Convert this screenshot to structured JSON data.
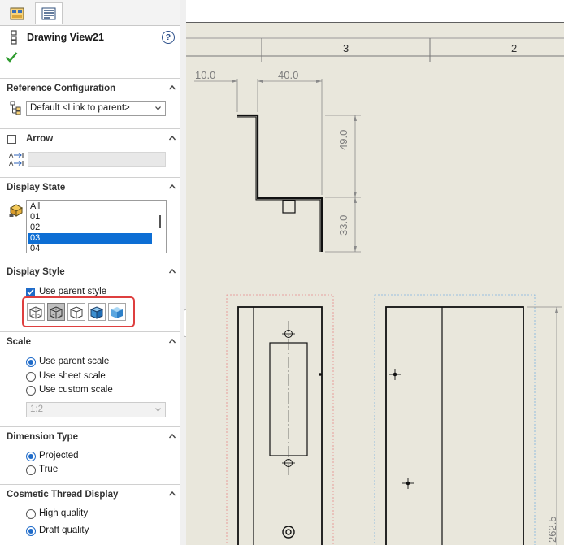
{
  "title": "Drawing View21",
  "help_label": "?",
  "sections": {
    "reference_configuration": {
      "header": "Reference Configuration",
      "value": "Default <Link to parent>"
    },
    "arrow": {
      "header": "Arrow",
      "checked": false
    },
    "display_state": {
      "header": "Display State",
      "items": [
        "All",
        "01",
        "02",
        "03",
        "04"
      ],
      "selected": "03"
    },
    "display_style": {
      "header": "Display Style",
      "use_parent_label": "Use parent style",
      "use_parent_checked": true,
      "buttons": [
        "wireframe",
        "hidden-lines-visible",
        "hidden-lines-removed",
        "shaded-with-edges",
        "shaded"
      ],
      "active_button": "hidden-lines-visible"
    },
    "scale": {
      "header": "Scale",
      "options": [
        "Use parent scale",
        "Use sheet scale",
        "Use custom scale"
      ],
      "selected": "Use parent scale",
      "custom_value": "1:2"
    },
    "dimension_type": {
      "header": "Dimension Type",
      "options": [
        "Projected",
        "True"
      ],
      "selected": "Projected"
    },
    "cosmetic_thread": {
      "header": "Cosmetic Thread Display",
      "options": [
        "High quality",
        "Draft quality"
      ],
      "selected": "Draft quality"
    }
  },
  "canvas": {
    "zone_labels": [
      "3",
      "2"
    ],
    "dimensions": [
      "10.0",
      "40.0",
      "49.0",
      "33.0",
      "262.5"
    ]
  },
  "colors": {
    "accent": "#1f6bc9",
    "selection": "#0d6ed4",
    "highlight_box": "#de3f3f",
    "sheet_background": "#e9e7dc"
  }
}
